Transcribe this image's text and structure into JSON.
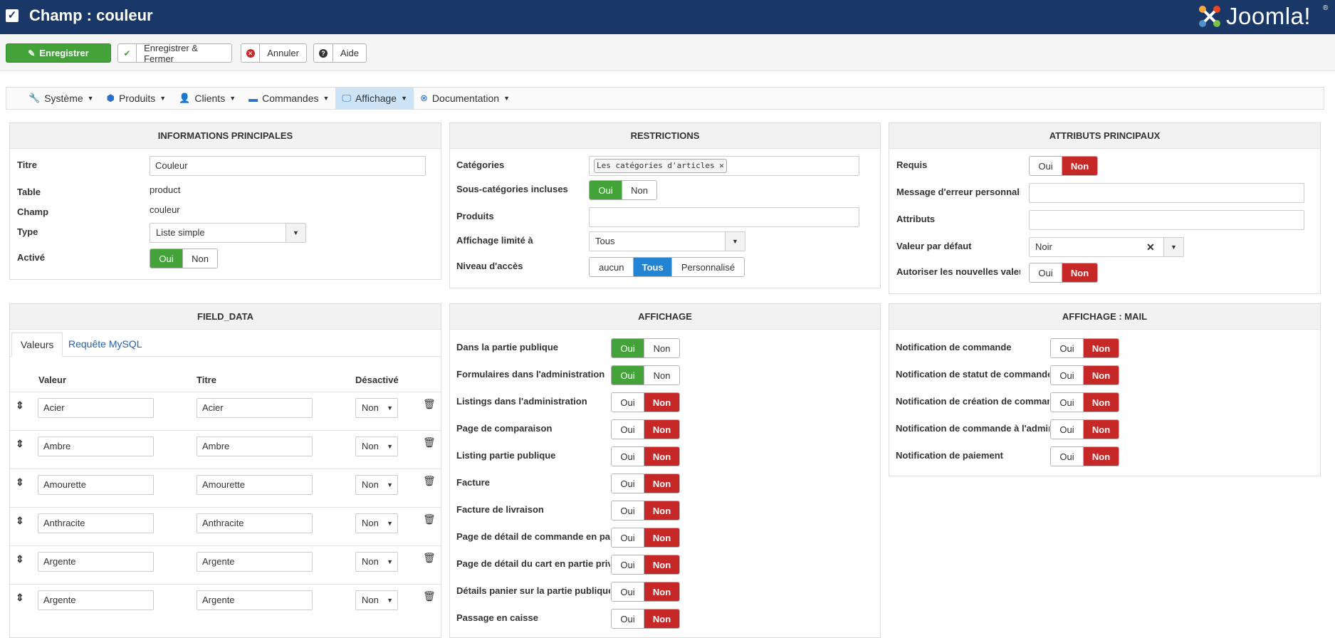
{
  "header": {
    "title": "Champ : couleur",
    "logo_text": "Joomla!",
    "logo_reg": "®"
  },
  "toolbar": {
    "save": "Enregistrer",
    "save_close": "Enregistrer & Fermer",
    "cancel": "Annuler",
    "help": "Aide"
  },
  "menu": {
    "items": [
      {
        "label": "Système",
        "icon": "wrench-icon"
      },
      {
        "label": "Produits",
        "icon": "cubes-icon"
      },
      {
        "label": "Clients",
        "icon": "user-icon"
      },
      {
        "label": "Commandes",
        "icon": "credit-card-icon"
      },
      {
        "label": "Affichage",
        "icon": "monitor-icon",
        "active": true
      },
      {
        "label": "Documentation",
        "icon": "life-ring-icon"
      }
    ]
  },
  "info": {
    "heading": "INFORMATIONS PRINCIPALES",
    "titre_label": "Titre",
    "titre_value": "Couleur",
    "table_label": "Table",
    "table_value": "product",
    "champ_label": "Champ",
    "champ_value": "couleur",
    "type_label": "Type",
    "type_value": "Liste simple",
    "active_label": "Activé",
    "yes": "Oui",
    "no": "Non"
  },
  "restrictions": {
    "heading": "RESTRICTIONS",
    "categories_label": "Catégories",
    "categories_tag": "Les catégories d'articles",
    "subcat_label": "Sous-catégories incluses",
    "products_label": "Produits",
    "limit_label": "Affichage limité à",
    "limit_value": "Tous",
    "access_label": "Niveau d'accès",
    "access_options": [
      "aucun",
      "Tous",
      "Personnalisé"
    ],
    "yes": "Oui",
    "no": "Non"
  },
  "attributes": {
    "heading": "ATTRIBUTS PRINCIPAUX",
    "required_label": "Requis",
    "error_label": "Message d'erreur personnalisé",
    "attrs_label": "Attributs",
    "default_label": "Valeur par défaut",
    "default_value": "Noir",
    "allow_new_label": "Autoriser les nouvelles valeurs",
    "yes": "Oui",
    "no": "Non"
  },
  "field_data": {
    "heading": "FIELD_DATA",
    "tab_values": "Valeurs",
    "tab_mysql": "Requête MySQL",
    "col_value": "Valeur",
    "col_title": "Titre",
    "col_disabled": "Désactivé",
    "rows": [
      {
        "value": "Acier",
        "title": "Acier",
        "disabled": "Non"
      },
      {
        "value": "Ambre",
        "title": "Ambre",
        "disabled": "Non"
      },
      {
        "value": "Amourette",
        "title": "Amourette",
        "disabled": "Non"
      },
      {
        "value": "Anthracite",
        "title": "Anthracite",
        "disabled": "Non"
      },
      {
        "value": "Argente",
        "title": "Argente",
        "disabled": "Non"
      },
      {
        "value": "Argente",
        "title": "Argente",
        "disabled": "Non"
      }
    ]
  },
  "display": {
    "heading": "AFFICHAGE",
    "yes": "Oui",
    "no": "Non",
    "rows": [
      {
        "label": "Dans la partie publique",
        "state": "yes"
      },
      {
        "label": "Formulaires dans l'administration",
        "state": "yes"
      },
      {
        "label": "Listings dans l'administration",
        "state": "no"
      },
      {
        "label": "Page de comparaison",
        "state": "no"
      },
      {
        "label": "Listing partie publique",
        "state": "no"
      },
      {
        "label": "Facture",
        "state": "no"
      },
      {
        "label": "Facture de livraison",
        "state": "no"
      },
      {
        "label": "Page de détail de commande en partie privée",
        "state": "no"
      },
      {
        "label": "Page de détail du cart en partie privée",
        "state": "no"
      },
      {
        "label": "Détails panier sur la partie publique",
        "state": "no"
      },
      {
        "label": "Passage en caisse",
        "state": "no"
      }
    ]
  },
  "mail": {
    "heading": "AFFICHAGE : MAIL",
    "yes": "Oui",
    "no": "Non",
    "rows": [
      {
        "label": "Notification de commande",
        "state": "no"
      },
      {
        "label": "Notification de statut de commande",
        "state": "no"
      },
      {
        "label": "Notification de création de commande",
        "state": "no"
      },
      {
        "label": "Notification de commande à l'administrateur",
        "state": "no"
      },
      {
        "label": "Notification de paiement",
        "state": "no"
      }
    ]
  },
  "colors": {
    "header_bg": "#1a3867",
    "success": "#43a339",
    "danger": "#c52827",
    "primary": "#2384d3",
    "active_menu": "#cde4f7"
  }
}
